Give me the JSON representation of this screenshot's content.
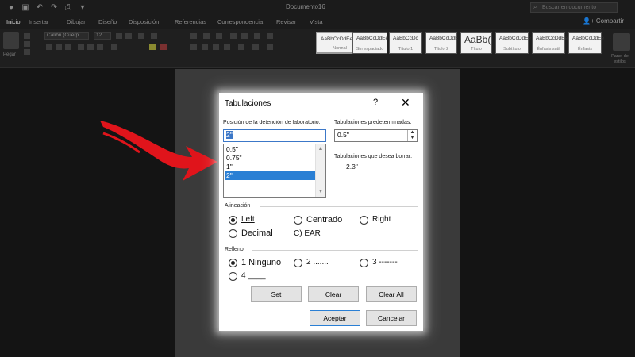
{
  "titlebar": {
    "document_title": "Documento16",
    "search_placeholder": "Buscar en documento"
  },
  "ribbon_tabs": [
    "Inicio",
    "Insertar",
    "Dibujar",
    "Diseño",
    "Disposición",
    "Referencias",
    "Correspondencia",
    "Revisar",
    "Vista"
  ],
  "share_label": "Compartir",
  "ribbon": {
    "paste_label": "Pegar",
    "font_name": "Calibri (Cuerp...",
    "font_size": "12",
    "styles": [
      {
        "preview": "AaBbCcDdEe",
        "name": "Normal"
      },
      {
        "preview": "AaBbCcDdEe",
        "name": "Sin espaciado"
      },
      {
        "preview": "AaBbCcDc",
        "name": "Título 1"
      },
      {
        "preview": "AaBbCcDdE",
        "name": "Título 2"
      },
      {
        "preview": "AaBb(",
        "name": "Título"
      },
      {
        "preview": "AaBbCcDdEe",
        "name": "Subtítulo"
      },
      {
        "preview": "AaBbCcDdEe",
        "name": "Énfasis sutil"
      },
      {
        "preview": "AaBbCcDdEe",
        "name": "Énfasis"
      }
    ],
    "styles_pane_label": "Panel de estilos"
  },
  "dialog": {
    "title": "Tabulaciones",
    "help": "?",
    "close": "✕",
    "tab_stop_label": "Posición de la detención de laboratorio:",
    "tab_stop_value": "2\"",
    "tab_stops": [
      "0.5\"",
      "0.75\"",
      "1\"",
      "2\""
    ],
    "selected_tab_stop_index": 3,
    "default_tabs_label": "Tabulaciones predeterminadas:",
    "default_tabs_value": "0.5\"",
    "to_clear_label": "Tabulaciones que desea borrar:",
    "to_clear_value": "2.3\"",
    "alignment_label": "Alineación",
    "alignment_options": [
      "Left",
      "Centrado",
      "Right",
      "Decimal",
      "C) EAR"
    ],
    "alignment_selected": "Left",
    "leader_label": "Relleno",
    "leader_options": [
      "1 Ninguno",
      "2 .......",
      "3 -------",
      "4 ____"
    ],
    "leader_selected": "1 Ninguno",
    "buttons": {
      "set": "Set",
      "clear": "Clear",
      "clear_all": "Clear All",
      "ok": "Aceptar",
      "cancel": "Cancelar"
    }
  },
  "colors": {
    "arrow": "#e0141b",
    "selection": "#2a7fd4",
    "app_background": "#141414"
  }
}
